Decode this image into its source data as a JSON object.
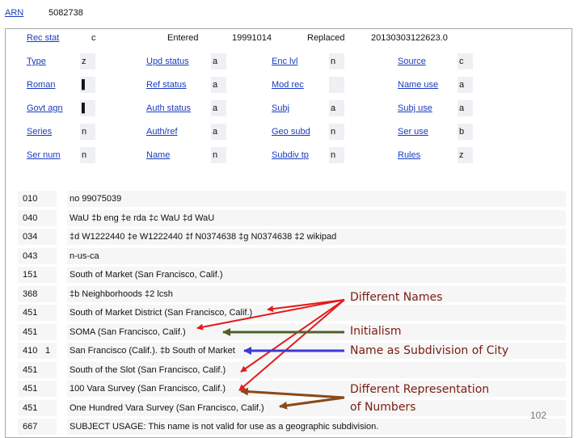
{
  "record": {
    "arn_label": "ARN",
    "arn_value": "5082738"
  },
  "top_row": [
    {
      "label": "Rec stat",
      "value": "c"
    },
    {
      "label": "Entered",
      "value": "19991014"
    },
    {
      "label": "Replaced",
      "value": "20130303122623.0"
    }
  ],
  "fixed_fields": [
    [
      {
        "label": "Type",
        "value": "z"
      },
      {
        "label": "Upd status",
        "value": "a"
      },
      {
        "label": "Enc lvl",
        "value": "n"
      },
      {
        "label": "Source",
        "value": "c"
      }
    ],
    [
      {
        "label": "Roman",
        "value": "▌"
      },
      {
        "label": "Ref status",
        "value": "a"
      },
      {
        "label": "Mod rec",
        "value": ""
      },
      {
        "label": "Name use",
        "value": "a"
      }
    ],
    [
      {
        "label": "Govt agn",
        "value": "▌"
      },
      {
        "label": "Auth status",
        "value": "a"
      },
      {
        "label": "Subj",
        "value": "a"
      },
      {
        "label": "Subj use",
        "value": "a"
      }
    ],
    [
      {
        "label": "Series",
        "value": "n"
      },
      {
        "label": "Auth/ref",
        "value": "a"
      },
      {
        "label": "Geo subd",
        "value": "n"
      },
      {
        "label": "Ser use",
        "value": "b"
      }
    ],
    [
      {
        "label": "Ser num",
        "value": "n"
      },
      {
        "label": "Name",
        "value": "n"
      },
      {
        "label": "Subdiv tp",
        "value": "n"
      },
      {
        "label": "Rules",
        "value": "z"
      }
    ]
  ],
  "fields": [
    {
      "tag": "010",
      "ind": "",
      "text": "no 99075039"
    },
    {
      "tag": "040",
      "ind": "",
      "text": "WaU ‡b eng ‡e rda ‡c WaU ‡d WaU"
    },
    {
      "tag": "034",
      "ind": "",
      "text": "‡d W1222440 ‡e W1222440 ‡f N0374638 ‡g N0374638 ‡2 wikipad"
    },
    {
      "tag": "043",
      "ind": "",
      "text": "n-us-ca"
    },
    {
      "tag": "151",
      "ind": "",
      "text": "South of Market (San Francisco, Calif.)"
    },
    {
      "tag": "368",
      "ind": "",
      "text": "‡b Neighborhoods ‡2 lcsh"
    },
    {
      "tag": "451",
      "ind": "",
      "text": "South of Market District (San Francisco, Calif.)"
    },
    {
      "tag": "451",
      "ind": "",
      "text": "SOMA (San Francisco, Calif.)"
    },
    {
      "tag": "410",
      "ind": "1",
      "text": "San Francisco (Calif.). ‡b South of Market"
    },
    {
      "tag": "451",
      "ind": "",
      "text": "South of the Slot (San Francisco, Calif.)"
    },
    {
      "tag": "451",
      "ind": "",
      "text": "100 Vara Survey (San Francisco, Calif.)"
    },
    {
      "tag": "451",
      "ind": "",
      "text": "One Hundred Vara Survey (San Francisco, Calif.)"
    },
    {
      "tag": "667",
      "ind": "",
      "text": "SUBJECT USAGE: This name is not valid for use as a geographic subdivision."
    }
  ],
  "annotations": {
    "different_names": "Different Names",
    "initialism": "Initialism",
    "subdivision": "Name as Subdivision of City",
    "numbers_line1": "Different Representation",
    "numbers_line2": "of Numbers"
  },
  "colors": {
    "red": "#e31b1b",
    "green": "#4f6228",
    "blue": "#3a3ad6",
    "brown": "#8a4a1a",
    "link": "#1a3bbf"
  },
  "page_number": "102"
}
